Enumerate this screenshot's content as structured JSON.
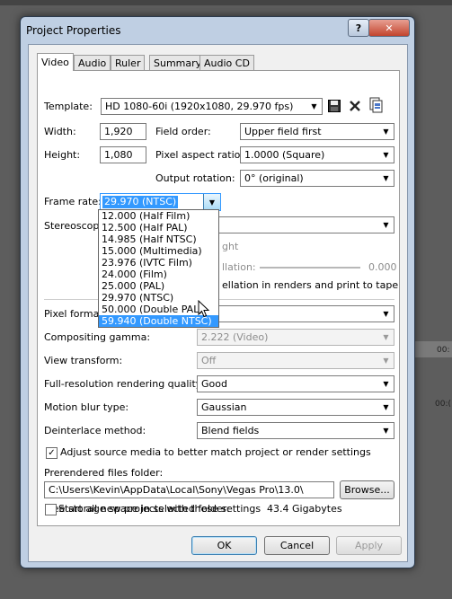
{
  "window": {
    "title": "Project Properties",
    "help_label": "?",
    "close_label": "✕"
  },
  "tabs": [
    {
      "label": "Video",
      "active": true
    },
    {
      "label": "Audio"
    },
    {
      "label": "Ruler"
    },
    {
      "label": "Summary"
    },
    {
      "label": "Audio CD"
    }
  ],
  "template": {
    "label": "Template:",
    "value": "HD 1080-60i (1920x1080, 29.970 fps)"
  },
  "width": {
    "label": "Width:",
    "value": "1,920"
  },
  "height": {
    "label": "Height:",
    "value": "1,080"
  },
  "field_order": {
    "label": "Field order:",
    "value": "Upper field first"
  },
  "pixel_aspect": {
    "label": "Pixel aspect ratio:",
    "value": "1.0000 (Square)"
  },
  "output_rotation": {
    "label": "Output rotation:",
    "value": "0° (original)"
  },
  "frame_rate": {
    "label": "Frame rate:",
    "value": "29.970 (NTSC)",
    "options": [
      "12.000 (Half Film)",
      "12.500 (Half PAL)",
      "14.985 (Half NTSC)",
      "15.000 (Multimedia)",
      "23.976 (IVTC Film)",
      "24.000 (Film)",
      "25.000 (PAL)",
      "29.970 (NTSC)",
      "50.000 (Double PAL)",
      "59.940 (Double NTSC)"
    ],
    "highlighted": "59.940 (Double NTSC)"
  },
  "stereoscopic": {
    "label": "Stereoscopic",
    "partial_right": "ght",
    "parallax_partial": "llation:",
    "parallax_value": "0.000",
    "note_partial": "ellation in renders and print to tape"
  },
  "pixel_format": {
    "label": "Pixel format:"
  },
  "compositing_gamma": {
    "label": "Compositing gamma:",
    "value": "2.222 (Video)"
  },
  "view_transform": {
    "label": "View transform:",
    "value": "Off"
  },
  "full_res_quality": {
    "label": "Full-resolution rendering quality:",
    "value": "Good"
  },
  "motion_blur": {
    "label": "Motion blur type:",
    "value": "Gaussian"
  },
  "deinterlace": {
    "label": "Deinterlace method:",
    "value": "Blend fields"
  },
  "adjust_source": {
    "label": "Adjust source media to better match project or render settings",
    "checked": true
  },
  "prerendered": {
    "label": "Prerendered files folder:",
    "path": "C:\\Users\\Kevin\\AppData\\Local\\Sony\\Vegas Pro\\13.0\\",
    "browse_label": "Browse..."
  },
  "storage": {
    "label": "Free storage space in selected folder:",
    "value": "43.4 Gigabytes"
  },
  "start_new": {
    "label": "Start all new projects with these settings",
    "checked": false
  },
  "buttons": {
    "ok": "OK",
    "cancel": "Cancel",
    "apply": "Apply"
  },
  "background": {
    "time_labels": [
      "00:",
      "00:("
    ]
  }
}
